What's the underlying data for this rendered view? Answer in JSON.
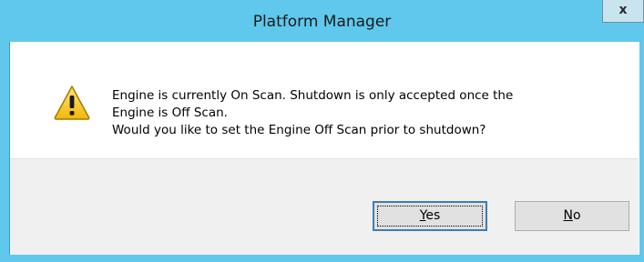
{
  "window": {
    "title": "Platform Manager",
    "close_glyph": "x"
  },
  "message": {
    "line1": "Engine is currently On Scan. Shutdown is only accepted once the",
    "line2": "Engine is Off Scan.",
    "line3": "Would you like to set the Engine Off Scan prior to shutdown?"
  },
  "icon": "warning-icon",
  "buttons": {
    "yes": {
      "mnemonic": "Y",
      "rest": "es"
    },
    "no": {
      "mnemonic": "N",
      "rest": "o"
    }
  },
  "colors": {
    "titlebar": "#5fc8ec",
    "warning_fill": "#f5c517",
    "warning_border": "#b08600"
  }
}
